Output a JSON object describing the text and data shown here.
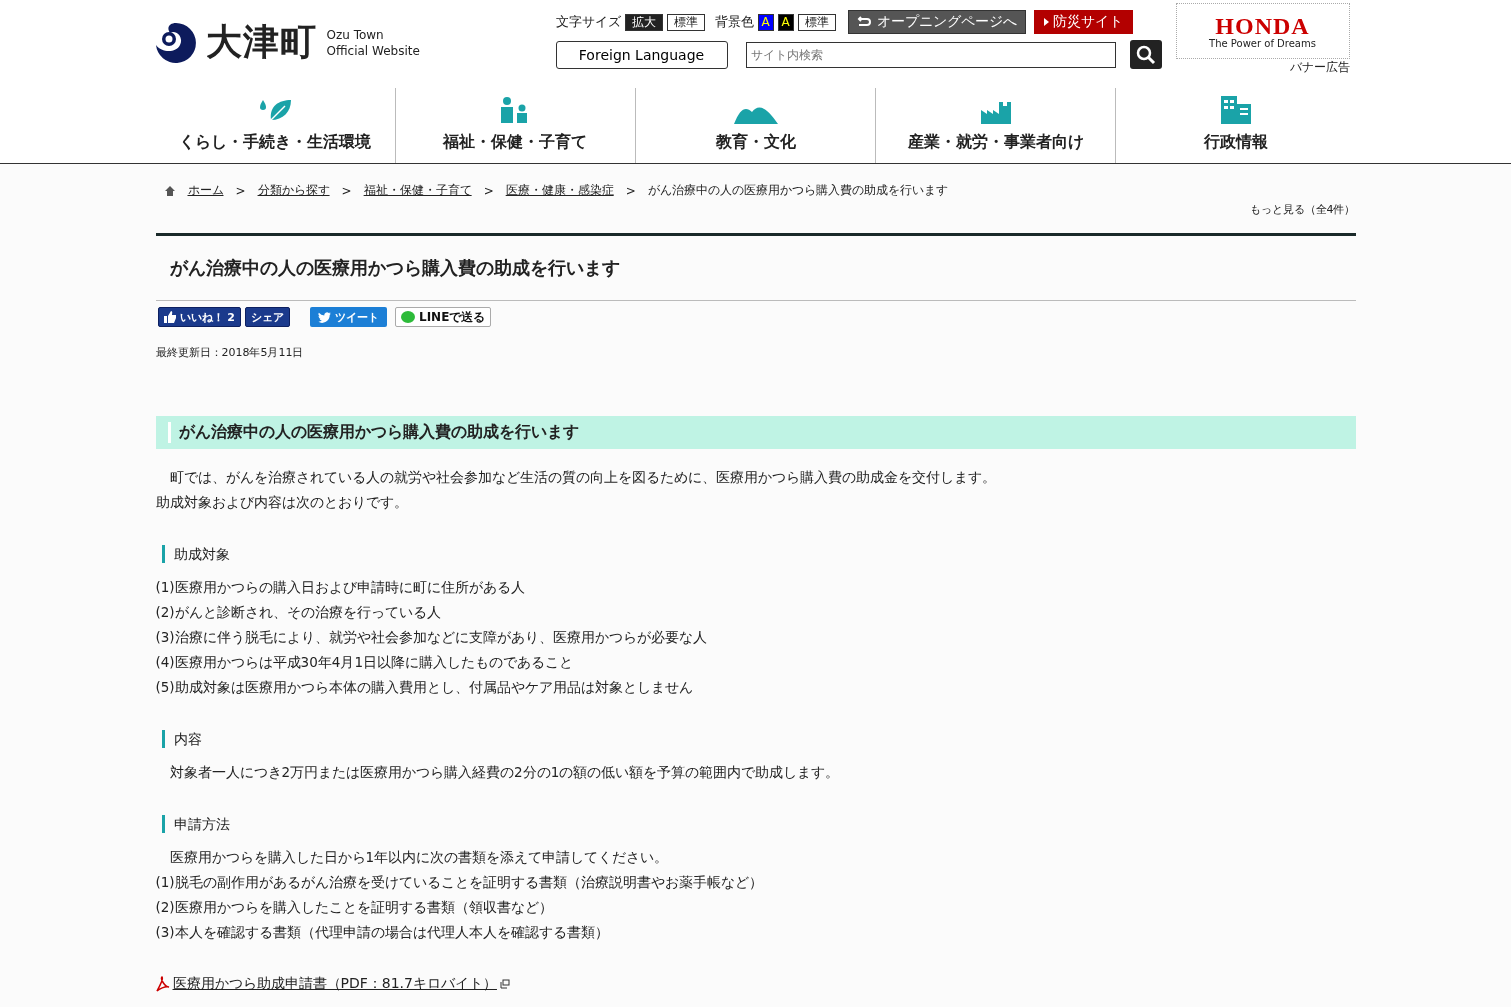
{
  "header": {
    "logo_title": "大津町",
    "logo_subtitle_1": "Ozu Town",
    "logo_subtitle_2": "Official Website",
    "text_size": {
      "label": "文字サイズ",
      "buttons": [
        {
          "label": "拡大",
          "kind": "dark"
        },
        {
          "label": "標準",
          "kind": "light"
        }
      ]
    },
    "bg_color": {
      "label": "背景色",
      "buttons": [
        {
          "label": "A",
          "color": "#0000ff"
        },
        {
          "label": "A",
          "color": "#000000"
        },
        {
          "label": "標準"
        }
      ]
    },
    "opening_link": "オープニングページへ",
    "disaster_link": "防災サイト",
    "foreign_language": "Foreign Language",
    "search": {
      "placeholder": "サイト内検索"
    },
    "banner": {
      "brand": "HONDA",
      "slogan": "The Power of Dreams",
      "caption": "バナー広告"
    }
  },
  "nav": [
    {
      "label": "くらし・手続き・生活環境",
      "kind": "leaf"
    },
    {
      "label": "福祉・保健・子育て",
      "kind": "family"
    },
    {
      "label": "教育・文化",
      "kind": "mountain"
    },
    {
      "label": "産業・就労・事業者向け",
      "kind": "factory"
    },
    {
      "label": "行政情報",
      "kind": "building"
    }
  ],
  "breadcrumb": {
    "items": [
      "ホーム",
      "分類から探す",
      "福祉・保健・子育て",
      "医療・健康・感染症"
    ],
    "separators": [
      ">",
      ">",
      ">",
      ">"
    ],
    "current": "がん治療中の人の医療用かつら購入費の助成を行います",
    "more": "もっと見る（全4件）"
  },
  "page_title": "がん治療中の人の医療用かつら購入費の助成を行います",
  "social": {
    "like": "いいね！ 2",
    "share": "シェア",
    "tweet": "ツイート",
    "line": "LINEで送る"
  },
  "updated": "最終更新日：2018年5月11日",
  "section_title": "がん治療中の人の医療用かつら購入費の助成を行います",
  "intro": [
    "町では、がんを治療されている人の就労や社会参加など生活の質の向上を図るために、医療用かつら購入費の助成金を交付します。",
    "助成対象および内容は次のとおりです。"
  ],
  "subsections": [
    {
      "heading": "助成対象",
      "lines": [
        "(1)医療用かつらの購入日および申請時に町に住所がある人",
        "(2)がんと診断され、その治療を行っている人",
        "(3)治療に伴う脱毛により、就労や社会参加などに支障があり、医療用かつらが必要な人",
        "(4)医療用かつらは平成30年4月1日以降に購入したものであること",
        "(5)助成対象は医療用かつら本体の購入費用とし、付属品やケア用品は対象としません"
      ]
    },
    {
      "heading": "内容",
      "lines": [
        "対象者一人につき2万円または医療用かつら購入経費の2分の1の額の低い額を予算の範囲内で助成します。"
      ],
      "indent": true
    },
    {
      "heading": "申請方法",
      "lines": [
        "医療用かつらを購入した日から1年以内に次の書類を添えて申請してください。",
        "(1)脱毛の副作用があるがん治療を受けていることを証明する書類（治療説明書やお薬手帳など）",
        "(2)医療用かつらを購入したことを証明する書類（領収書など）",
        "(3)本人を確認する書類（代理申請の場合は代理人本人を確認する書類）"
      ],
      "indent_first": true
    }
  ],
  "pdf_link": "医療用かつら助成申請書（PDF：81.7キロバイト）"
}
